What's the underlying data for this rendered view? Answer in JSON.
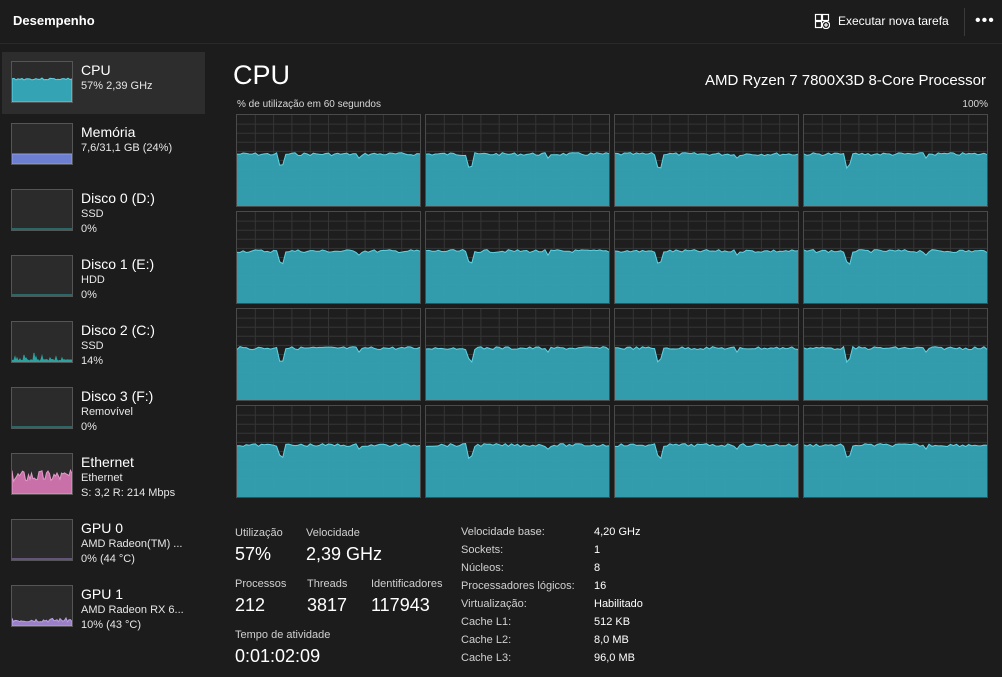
{
  "app": {
    "title": "Desempenho",
    "new_task_label": "Executar nova tarefa",
    "more_label": "•••"
  },
  "colors": {
    "cpu_fill": "#34a3b4",
    "cpu_line": "#5fd3e3",
    "memory_fill": "#6d7fd0",
    "disk_line": "#2aa3a0",
    "ethernet_fill": "#c970a8",
    "gpu_fill": "#9b7fc8"
  },
  "sidebar": {
    "items": [
      {
        "name": "CPU",
        "sub1": "57% 2,39 GHz",
        "sub2": ""
      },
      {
        "name": "Memória",
        "sub1": "7,6/31,1 GB (24%)",
        "sub2": ""
      },
      {
        "name": "Disco 0 (D:)",
        "sub1": "SSD",
        "sub2": "0%"
      },
      {
        "name": "Disco 1 (E:)",
        "sub1": "HDD",
        "sub2": "0%"
      },
      {
        "name": "Disco 2 (C:)",
        "sub1": "SSD",
        "sub2": "14%"
      },
      {
        "name": "Disco 3 (F:)",
        "sub1": "Removível",
        "sub2": "0%"
      },
      {
        "name": "Ethernet",
        "sub1": "Ethernet",
        "sub2": "S: 3,2 R: 214 Mbps"
      },
      {
        "name": "GPU 0",
        "sub1": "AMD Radeon(TM) ...",
        "sub2": "0% (44 °C)"
      },
      {
        "name": "GPU 1",
        "sub1": "AMD Radeon RX 6...",
        "sub2": "10% (43 °C)"
      }
    ]
  },
  "main": {
    "title": "CPU",
    "model": "AMD Ryzen 7 7800X3D 8-Core Processor",
    "util_label": "% de utilização em 60 segundos",
    "max_label": "100%",
    "core_count": 16,
    "core_level_percent": 57,
    "stats": {
      "utilization_label": "Utilização",
      "utilization_value": "57%",
      "speed_label": "Velocidade",
      "speed_value": "2,39 GHz",
      "processes_label": "Processos",
      "processes_value": "212",
      "threads_label": "Threads",
      "threads_value": "3817",
      "handles_label": "Identificadores",
      "handles_value": "117943",
      "uptime_label": "Tempo de atividade",
      "uptime_value": "0:01:02:09"
    },
    "specs": [
      {
        "k": "Velocidade base:",
        "v": "4,20 GHz"
      },
      {
        "k": "Sockets:",
        "v": "1"
      },
      {
        "k": "Núcleos:",
        "v": "8"
      },
      {
        "k": "Processadores lógicos:",
        "v": "16"
      },
      {
        "k": "Virtualização:",
        "v": "Habilitado"
      },
      {
        "k": "Cache L1:",
        "v": "512 KB"
      },
      {
        "k": "Cache L2:",
        "v": "8,0 MB"
      },
      {
        "k": "Cache L3:",
        "v": "96,0 MB"
      }
    ]
  }
}
